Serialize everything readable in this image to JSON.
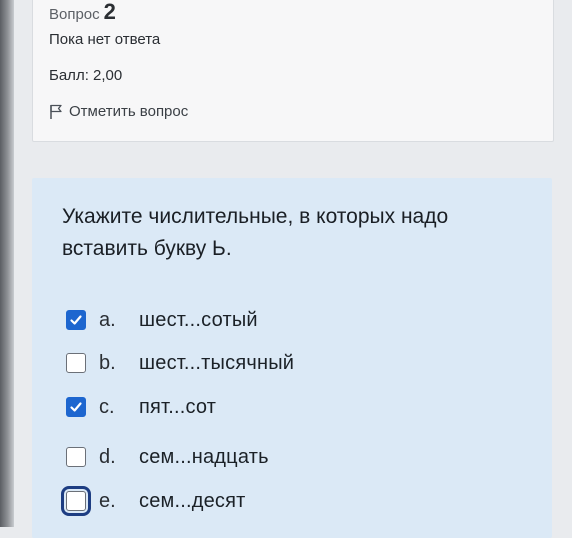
{
  "question_info": {
    "number_label": "Вопрос",
    "number_value": "2",
    "state": "Пока нет ответа",
    "grade": "Балл: 2,00",
    "flag_label": "Отметить вопрос"
  },
  "question": {
    "text": "Укажите числительные, в которых надо\nвставить букву Ь.",
    "answers": [
      {
        "letter": "a.",
        "text": "шест...сотый",
        "checked": true
      },
      {
        "letter": "b.",
        "text": "шест...тысячный",
        "checked": false
      },
      {
        "letter": "c.",
        "text": "пят...сот",
        "checked": true
      },
      {
        "letter": "d.",
        "text": "сем...надцать",
        "checked": false
      },
      {
        "letter": "e.",
        "text": "сем...десят",
        "checked": false,
        "focused": true
      }
    ]
  },
  "colors": {
    "content_background": "#dbe9f6",
    "checkbox_checked": "#1d66cf",
    "focus_outline": "#1d3d82"
  },
  "icons": {
    "flag": "flag-icon",
    "check": "checkmark-icon"
  }
}
